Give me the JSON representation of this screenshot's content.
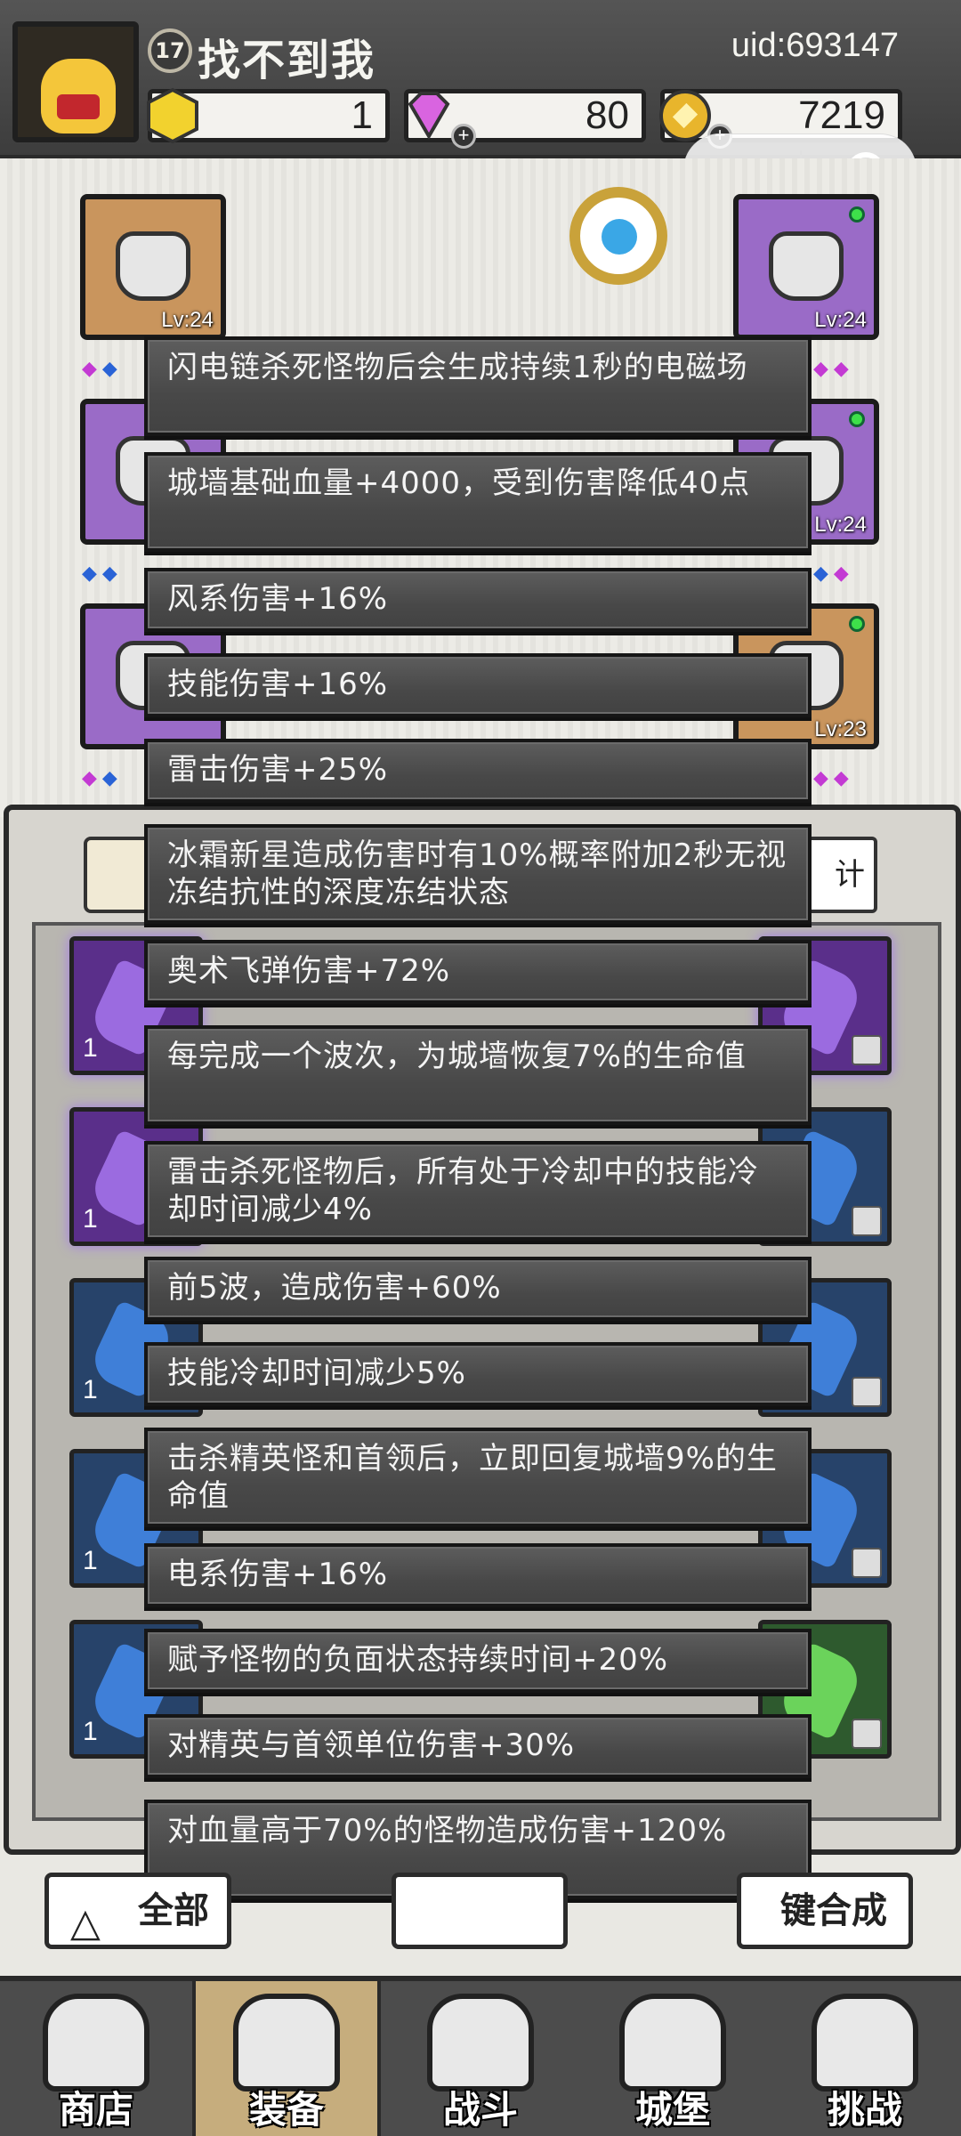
{
  "header": {
    "level": "17",
    "player_name": "找不到我",
    "uid": "uid:693147",
    "resources": [
      {
        "name": "gold-token",
        "value": "1"
      },
      {
        "name": "diamond",
        "value": "80"
      },
      {
        "name": "coin",
        "value": "7219"
      }
    ]
  },
  "equipment": {
    "slots": [
      {
        "level": "Lv:24"
      },
      {
        "level": "Lv:24"
      },
      {
        "level": "Lv:24"
      },
      {
        "level": "Lv:23"
      }
    ]
  },
  "panel": {
    "stats_button": "计",
    "item_counts": [
      "1",
      "1",
      "1",
      "1",
      "1"
    ]
  },
  "tooltips": [
    "闪电链杀死怪物后会生成持续1秒的电磁场",
    "城墙基础血量+4000，受到伤害降低40点",
    "风系伤害+16%",
    "技能伤害+16%",
    "雷击伤害+25%",
    "冰霜新星造成伤害时有10%概率附加2秒无视冻结抗性的深度冻结状态",
    "奥术飞弹伤害+72%",
    "每完成一个波次，为城墙恢复7%的生命值",
    "雷击杀死怪物后，所有处于冷却中的技能冷却时间减少4%",
    "前5波，造成伤害+60%",
    "技能冷却时间减少5%",
    "击杀精英怪和首领后，立即回复城墙9%的生命值",
    "电系伤害+16%",
    "赋予怪物的负面状态持续时间+20%",
    "对精英与首领单位伤害+30%",
    "对血量高于70%的怪物造成伤害+120%"
  ],
  "buttons": {
    "filter_all": "全部",
    "merge": "键合成"
  },
  "nav": [
    {
      "label": "商店"
    },
    {
      "label": "装备"
    },
    {
      "label": "战斗"
    },
    {
      "label": "城堡"
    },
    {
      "label": "挑战"
    }
  ]
}
